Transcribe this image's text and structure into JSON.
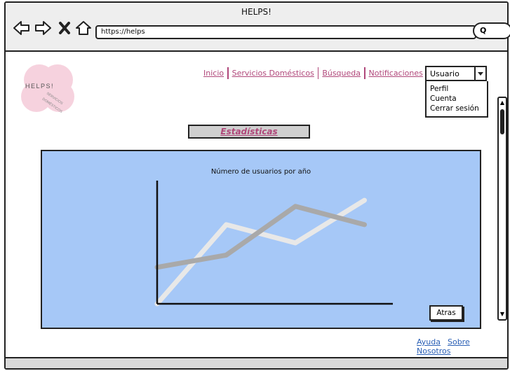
{
  "window": {
    "title": "HELPS!"
  },
  "browser": {
    "url": "https://helps",
    "search_glyph": "Q"
  },
  "logo": {
    "name": "HELPS!",
    "tagline": "SERVICIOS DOMÉSTICOS",
    "color": "#f6cedb"
  },
  "nav": {
    "items": [
      {
        "label": "Inicio"
      },
      {
        "label": "Servicios Domésticos"
      },
      {
        "label": "Búsqueda"
      },
      {
        "label": "Notificaciones"
      }
    ]
  },
  "user_menu": {
    "selected": "Usuario",
    "options": [
      "Perfil",
      "Cuenta",
      "Cerrar sesión"
    ]
  },
  "section": {
    "title": "Estadísticas"
  },
  "chart_data": {
    "type": "line",
    "title": "Número de usuarios por año",
    "xlabel": "",
    "ylabel": "",
    "x": [
      0,
      1,
      2,
      3
    ],
    "ylim": [
      0,
      10
    ],
    "grid": false,
    "series": [
      {
        "color": "#e8e8e8",
        "values": [
          0,
          6.5,
          5,
          8.5
        ]
      },
      {
        "color": "#a9a9a9",
        "values": [
          3,
          4,
          8,
          6.5
        ]
      }
    ]
  },
  "buttons": {
    "back": "Atras"
  },
  "footer": {
    "links": [
      "Ayuda",
      "Sobre Nosotros"
    ]
  },
  "colors": {
    "accent": "#b0477a",
    "panel": "#a6c8f7",
    "link": "#2a5fb5"
  }
}
